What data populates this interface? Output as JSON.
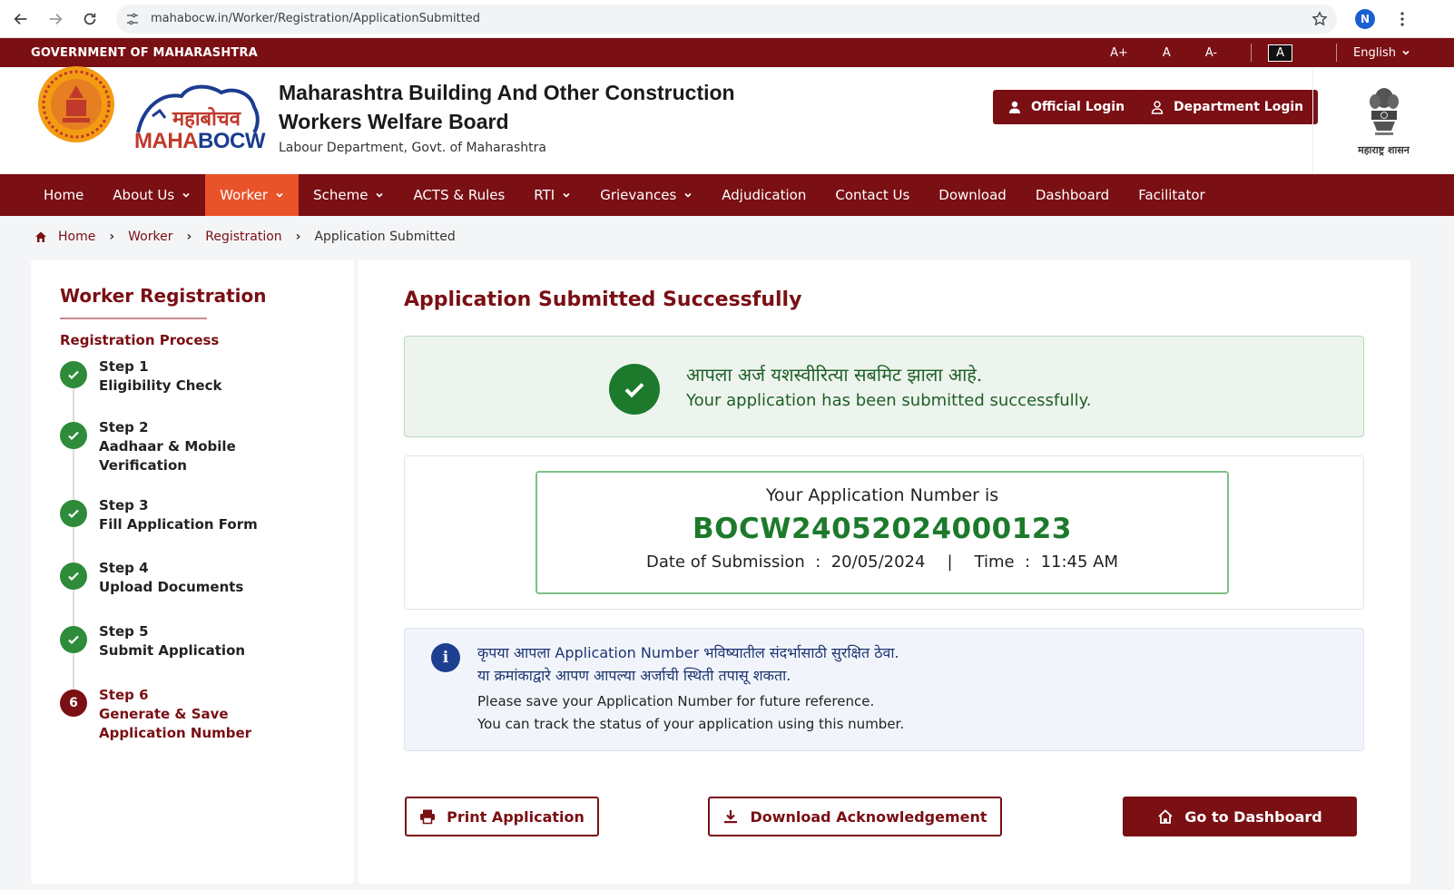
{
  "browser": {
    "url": "mahabocw.in/Worker/Registration/ApplicationSubmitted",
    "profile_initial": "N"
  },
  "topbar": {
    "gov_label": "GOVERNMENT OF MAHARASHTRA",
    "font_increase": "A+",
    "font_normal": "A",
    "font_decrease": "A-",
    "contrast": "A",
    "language": "English"
  },
  "header": {
    "logo_devanagari": "महाबोचव",
    "logo_text_red": "MAHA",
    "logo_text_blue": "BOCW",
    "title_line1": "Maharashtra Building And Other Construction",
    "title_line2": "Workers Welfare Board",
    "subtitle": "Labour Department, Govt. of Maharashtra",
    "official_login": "Official Login",
    "department_login": "Department Login",
    "emblem_caption": "महाराष्ट्र शासन"
  },
  "nav": {
    "items": [
      {
        "label": "Home"
      },
      {
        "label": "About Us"
      },
      {
        "label": "Worker"
      },
      {
        "label": "Scheme"
      },
      {
        "label": "ACTS & Rules"
      },
      {
        "label": "RTI"
      },
      {
        "label": "Grievances"
      },
      {
        "label": "Adjudication"
      },
      {
        "label": "Contact Us"
      },
      {
        "label": "Download"
      },
      {
        "label": "Dashboard"
      },
      {
        "label": "Facilitator"
      }
    ]
  },
  "breadcrumb": {
    "items": [
      "Home",
      "Worker",
      "Registration",
      "Application Submitted"
    ]
  },
  "sidebar": {
    "title": "Worker Registration",
    "process_label": "Registration Process",
    "steps": [
      {
        "step": "Step 1",
        "name": "Eligibility Check"
      },
      {
        "step": "Step 2",
        "name": "Aadhaar & Mobile",
        "name2": "Verification"
      },
      {
        "step": "Step 3",
        "name": "Fill Application Form"
      },
      {
        "step": "Step 4",
        "name": "Upload Documents"
      },
      {
        "step": "Step 5",
        "name": "Submit Application"
      },
      {
        "step": "Step 6",
        "name": "Generate & Save",
        "name2": "Application Number",
        "badge": "6"
      }
    ]
  },
  "main": {
    "title": "Application Submitted Successfully",
    "success_marathi": "आपला अर्ज यशस्वीरित्या सबमिट झाला आहे.",
    "success_english": "Your application has been submitted successfully.",
    "app_number_label": "Your Application Number is",
    "app_number": "BOCW24052024000123",
    "date_label": "Date of Submission",
    "date_value": "20/05/2024",
    "time_label": "Time",
    "time_value": "11:45 AM",
    "info_mr_1": "कृपया आपला Application Number भविष्यातील संदर्भासाठी सुरक्षित ठेवा.",
    "info_mr_2": "या क्रमांकाद्वारे आपण आपल्या अर्जाची स्थिती तपासू शकता.",
    "info_en_1": "Please save your Application Number for future reference.",
    "info_en_2": "You can track the status of your application using this number.",
    "print_button": "Print Application",
    "download_button": "Download Acknowledgement",
    "dashboard_button": "Go to Dashboard"
  },
  "colors": {
    "brand": "#7a0f14",
    "accent": "#e8532a",
    "success": "#1d7a2c",
    "info": "#1d3f8f"
  }
}
